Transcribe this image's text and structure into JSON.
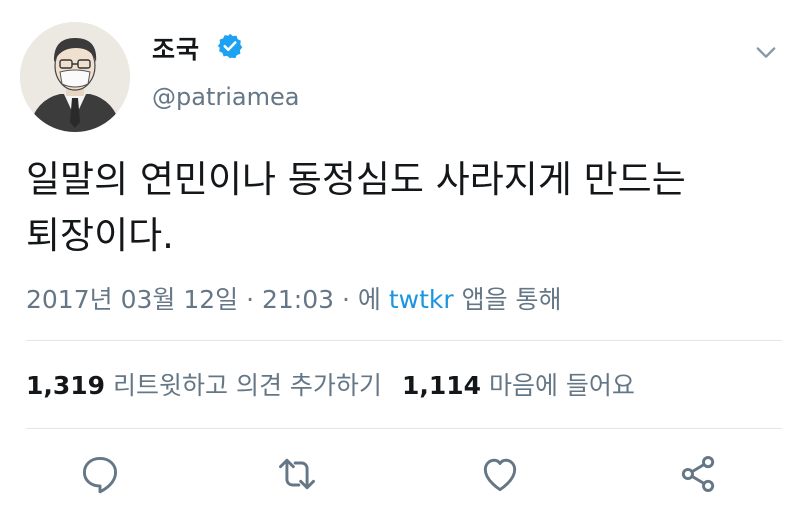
{
  "profile": {
    "display_name": "조국",
    "handle": "@patriamea"
  },
  "tweet": {
    "text_line1": "일말의 연민이나 동정심도 사라지게 만드는",
    "text_line2": "퇴장이다."
  },
  "meta": {
    "timestamp": "2017년 03월 12일 · 21:03 · ",
    "via_prefix": "에 ",
    "via_link": "twtkr",
    "via_suffix": " 앱을 통해"
  },
  "stats": {
    "retweet_count": "1,319",
    "retweet_label": "리트윗하고 의견 추가하기",
    "like_count": "1,114",
    "like_label": "마음에 들어요"
  },
  "colors": {
    "verified_blue": "#1da1f2",
    "link_blue": "#1b95e0",
    "secondary_gray": "#657786",
    "text_dark": "#14171a"
  },
  "icons": [
    "verified-badge-icon",
    "chevron-down-icon",
    "reply-icon",
    "retweet-icon",
    "like-icon",
    "share-icon"
  ]
}
